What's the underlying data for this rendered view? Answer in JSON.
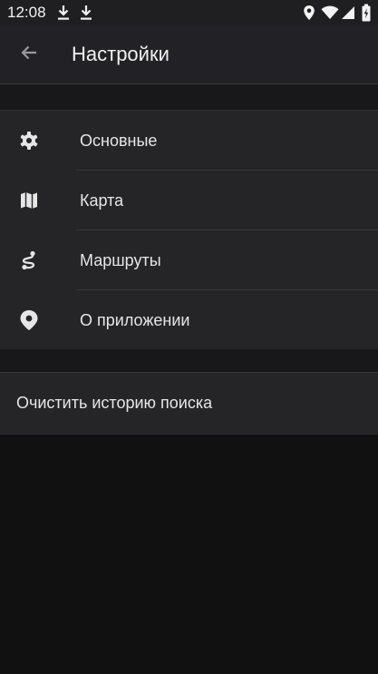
{
  "status_bar": {
    "time": "12:08",
    "icons": [
      "download-icon",
      "download-icon",
      "location-icon",
      "wifi-icon",
      "signal-icon",
      "battery-charging-icon"
    ]
  },
  "header": {
    "back_icon": "arrow-left-icon",
    "title": "Настройки"
  },
  "menu": {
    "items": [
      {
        "label": "Основные",
        "icon": "gear-icon"
      },
      {
        "label": "Карта",
        "icon": "map-icon"
      },
      {
        "label": "Маршруты",
        "icon": "route-icon"
      },
      {
        "label": "О приложении",
        "icon": "map-pin-icon"
      }
    ]
  },
  "actions": {
    "clear_history_label": "Очистить историю поиска"
  },
  "colors": {
    "background": "#111112",
    "surface": "#252528",
    "app_bar": "#222226",
    "text": "#e6e6e6",
    "divider": "#38383c"
  }
}
